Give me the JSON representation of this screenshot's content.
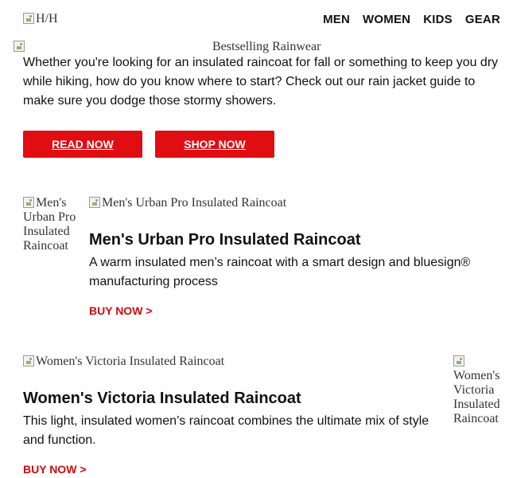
{
  "header": {
    "logo_alt": "H/H",
    "nav": [
      "MEN",
      "WOMEN",
      "KIDS",
      "GEAR"
    ]
  },
  "hero": {
    "image_alt": "Bestselling Rainwear",
    "intro": "Whether you're looking for an insulated raincoat for fall or something to keep you dry while hiking, how do you know where to start? Check out our rain jacket guide to make sure you dodge those stormy showers.",
    "read_label": "READ NOW",
    "shop_label": "SHOP NOW"
  },
  "products": [
    {
      "thumb_alt": "Men's Urban Pro Insulated Raincoat",
      "banner_alt": "Men's Urban Pro Insulated Raincoat",
      "title": "Men's Urban Pro Insulated Raincoat",
      "description": "A warm insulated men’s raincoat with a smart design and bluesign® manufacturing process",
      "buy_label": "BUY NOW >"
    },
    {
      "thumb_alt": "Women's Victoria Insulated Raincoat",
      "banner_alt": "Women's Victoria Insulated Raincoat",
      "title": "Women's Victoria Insulated Raincoat",
      "description": "This light, insulated women’s raincoat combines the ultimate mix of style and function.",
      "buy_label": "BUY NOW >"
    }
  ],
  "colors": {
    "accent": "#e00d13",
    "link": "#d10a10",
    "text": "#111111"
  },
  "icons": {
    "broken_image": "broken-image-icon"
  }
}
